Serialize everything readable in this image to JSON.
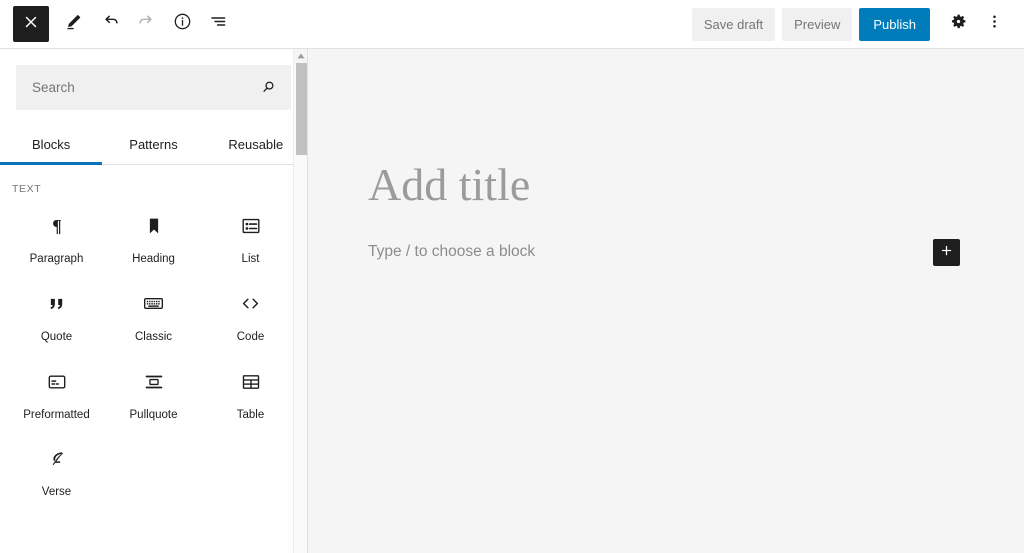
{
  "topbar": {
    "close_label": "Close block inserter",
    "close_icon": "close-icon",
    "left_tools": [
      {
        "name": "edit-icon",
        "label": "Edit",
        "disabled": false
      },
      {
        "name": "undo-icon",
        "label": "Undo",
        "disabled": false
      },
      {
        "name": "redo-icon",
        "label": "Redo",
        "disabled": true
      },
      {
        "name": "info-icon",
        "label": "Details",
        "disabled": false
      },
      {
        "name": "list-view-icon",
        "label": "List view",
        "disabled": false
      }
    ],
    "save_draft_label": "Save draft",
    "preview_label": "Preview",
    "publish_label": "Publish",
    "settings_icon": "gear-icon",
    "more_icon": "ellipsis-vertical-icon",
    "publish_color": "#007cba"
  },
  "inserter": {
    "search": {
      "placeholder": "Search",
      "value": "",
      "icon": "search-icon"
    },
    "tabs": [
      {
        "label": "Blocks",
        "active": true
      },
      {
        "label": "Patterns",
        "active": false
      },
      {
        "label": "Reusable",
        "active": false
      }
    ],
    "active_tab_color": "#0b74b8",
    "category": "TEXT",
    "blocks": [
      {
        "label": "Paragraph",
        "icon": "paragraph-icon"
      },
      {
        "label": "Heading",
        "icon": "heading-icon"
      },
      {
        "label": "List",
        "icon": "list-icon"
      },
      {
        "label": "Quote",
        "icon": "quote-icon"
      },
      {
        "label": "Classic",
        "icon": "classic-icon"
      },
      {
        "label": "Code",
        "icon": "code-icon"
      },
      {
        "label": "Preformatted",
        "icon": "preformatted-icon"
      },
      {
        "label": "Pullquote",
        "icon": "pullquote-icon"
      },
      {
        "label": "Table",
        "icon": "table-icon"
      },
      {
        "label": "Verse",
        "icon": "verse-icon"
      }
    ]
  },
  "canvas": {
    "title_placeholder": "Add title",
    "block_prompt": "Type / to choose a block",
    "add_block_icon": "plus-icon"
  }
}
